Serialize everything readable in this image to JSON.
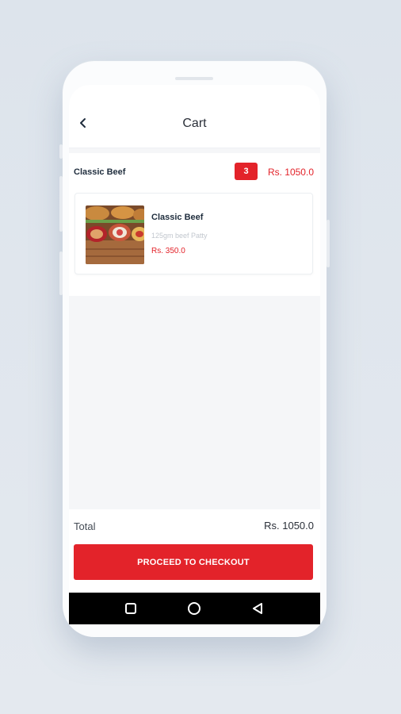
{
  "header": {
    "title": "Cart"
  },
  "cart": {
    "section": {
      "name": "Classic Beef",
      "quantity": "3",
      "total": "Rs. 1050.0"
    },
    "items": [
      {
        "name": "Classic Beef",
        "description": "125gm beef Patty",
        "price": "Rs. 350.0",
        "image_icon": "burger-photo"
      }
    ]
  },
  "footer": {
    "total_label": "Total",
    "total_value": "Rs. 1050.0",
    "checkout_label": "PROCEED TO CHECKOUT"
  },
  "navbar": {
    "icons": [
      "recent-apps-icon",
      "home-icon",
      "back-nav-icon"
    ]
  },
  "colors": {
    "accent": "#e3232a",
    "text": "#1f2d3d",
    "muted": "#c2c7ce"
  }
}
